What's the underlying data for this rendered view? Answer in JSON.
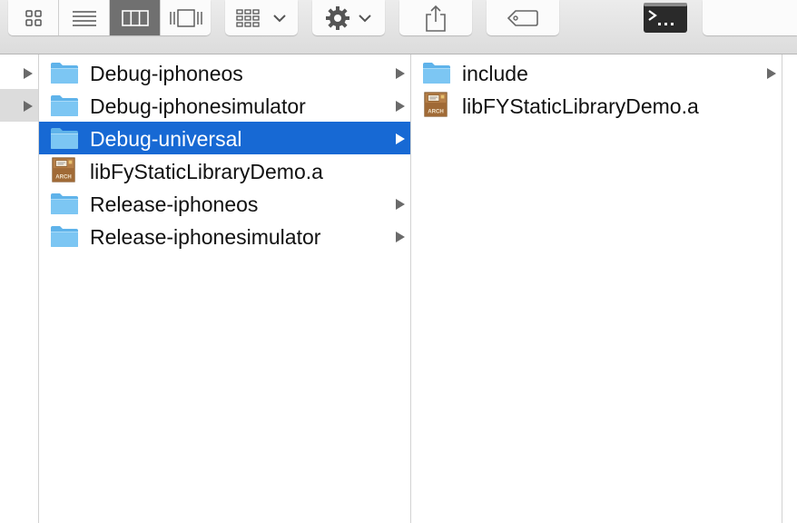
{
  "toolbar": {
    "view_buttons": [
      {
        "name": "icon-view",
        "icon": "grid-icon",
        "active": false
      },
      {
        "name": "list-view",
        "icon": "list-icon",
        "active": false
      },
      {
        "name": "column-view",
        "icon": "columns-icon",
        "active": true
      },
      {
        "name": "coverflow-view",
        "icon": "coverflow-icon",
        "active": false
      }
    ],
    "arrange_icon": "arrange-grid-icon",
    "action_icon": "gear-icon",
    "share_icon": "share-icon",
    "tag_icon": "tag-icon",
    "terminal_icon": "terminal-icon",
    "terminal_glyph": ">_"
  },
  "columns": {
    "col0": [
      {
        "label": "",
        "has_children": true,
        "selected": false
      },
      {
        "label": "",
        "has_children": true,
        "selected": "dim"
      }
    ],
    "col1": [
      {
        "label": "Debug-iphoneos",
        "type": "folder",
        "has_children": true,
        "selected": false
      },
      {
        "label": "Debug-iphonesimulator",
        "type": "folder",
        "has_children": true,
        "selected": false
      },
      {
        "label": "Debug-universal",
        "type": "folder",
        "has_children": true,
        "selected": true
      },
      {
        "label": "libFyStaticLibraryDemo.a",
        "type": "archive",
        "has_children": false,
        "selected": false
      },
      {
        "label": "Release-iphoneos",
        "type": "folder",
        "has_children": true,
        "selected": false
      },
      {
        "label": "Release-iphonesimulator",
        "type": "folder",
        "has_children": true,
        "selected": false
      }
    ],
    "col2": [
      {
        "label": "include",
        "type": "folder",
        "has_children": true,
        "selected": false
      },
      {
        "label": "libFYStaticLibraryDemo.a",
        "type": "archive",
        "has_children": false,
        "selected": false
      }
    ]
  },
  "archive_badge": "ARCH",
  "colors": {
    "selection": "#1769d4",
    "folder": "#6dbdf1",
    "archive": "#b4804a"
  }
}
